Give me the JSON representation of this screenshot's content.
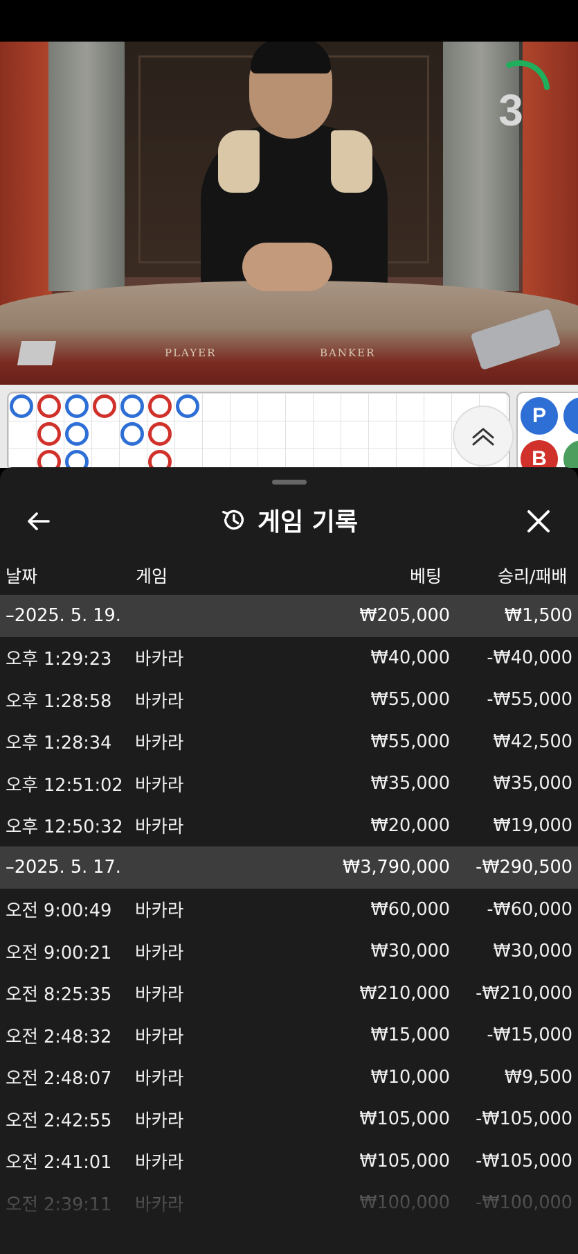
{
  "video": {
    "table_labels": [
      "PLAYER",
      "BANKER"
    ],
    "countdown": "3"
  },
  "roadmap": {
    "side_labels": [
      "P",
      "B"
    ]
  },
  "sheet": {
    "title": "게임 기록",
    "columns": [
      "날짜",
      "게임",
      "베팅",
      "승리/패배"
    ],
    "groups": [
      {
        "date": "–2025. 5. 19.",
        "bet_total": "₩205,000",
        "result_total": "₩1,500",
        "rows": [
          {
            "time": "오후 1:29:23",
            "game": "바카라",
            "bet": "₩40,000",
            "result": "-₩40,000"
          },
          {
            "time": "오후 1:28:58",
            "game": "바카라",
            "bet": "₩55,000",
            "result": "-₩55,000"
          },
          {
            "time": "오후 1:28:34",
            "game": "바카라",
            "bet": "₩55,000",
            "result": "₩42,500"
          },
          {
            "time": "오후 12:51:02",
            "game": "바카라",
            "bet": "₩35,000",
            "result": "₩35,000"
          },
          {
            "time": "오후 12:50:32",
            "game": "바카라",
            "bet": "₩20,000",
            "result": "₩19,000"
          }
        ]
      },
      {
        "date": "–2025. 5. 17.",
        "bet_total": "₩3,790,000",
        "result_total": "-₩290,500",
        "rows": [
          {
            "time": "오전 9:00:49",
            "game": "바카라",
            "bet": "₩60,000",
            "result": "-₩60,000"
          },
          {
            "time": "오전 9:00:21",
            "game": "바카라",
            "bet": "₩30,000",
            "result": "₩30,000"
          },
          {
            "time": "오전 8:25:35",
            "game": "바카라",
            "bet": "₩210,000",
            "result": "-₩210,000"
          },
          {
            "time": "오전 2:48:32",
            "game": "바카라",
            "bet": "₩15,000",
            "result": "-₩15,000"
          },
          {
            "time": "오전 2:48:07",
            "game": "바카라",
            "bet": "₩10,000",
            "result": "₩9,500"
          },
          {
            "time": "오전 2:42:55",
            "game": "바카라",
            "bet": "₩105,000",
            "result": "-₩105,000"
          },
          {
            "time": "오전 2:41:01",
            "game": "바카라",
            "bet": "₩105,000",
            "result": "-₩105,000"
          },
          {
            "time": "오전 2:39:11",
            "game": "바카라",
            "bet": "₩100,000",
            "result": "-₩100,000"
          }
        ]
      }
    ]
  }
}
